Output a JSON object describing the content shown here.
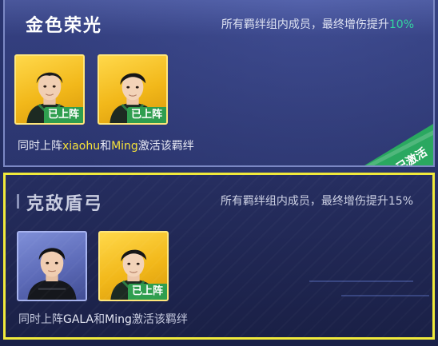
{
  "bonds": [
    {
      "title": "金色荣光",
      "effect_text": "所有羁绊组内成员，最终增伤提升",
      "effect_percent": "10%",
      "members": [
        {
          "badge": "已上阵",
          "frame": "gold"
        },
        {
          "badge": "已上阵",
          "frame": "gold"
        }
      ],
      "condition": {
        "prefix": "同时上阵",
        "player1": "xiaohu",
        "joiner": "和",
        "player2": "Ming",
        "suffix": "激活该羁绊"
      },
      "status": "已激活",
      "selected": false
    },
    {
      "title": "克敌盾弓",
      "effect_text": "所有羁绊组内成员，最终增伤提升",
      "effect_percent": "15%",
      "members": [
        {
          "badge": "",
          "frame": "blue"
        },
        {
          "badge": "已上阵",
          "frame": "gold"
        }
      ],
      "condition": {
        "prefix": "同时上阵",
        "player1": "GALA",
        "joiner": "和",
        "player2": "Ming",
        "suffix": "激活该羁绊"
      },
      "status": "",
      "selected": true
    }
  ],
  "colors": {
    "highlight_yellow": "#f6e23a",
    "percent_green": "#33d6a0",
    "selected_border": "#f1ea3b",
    "onfield_badge": "#2f9e4f",
    "activated_ribbon": "#2aa860"
  },
  "icons": [
    "player-portrait",
    "activated-ribbon"
  ]
}
